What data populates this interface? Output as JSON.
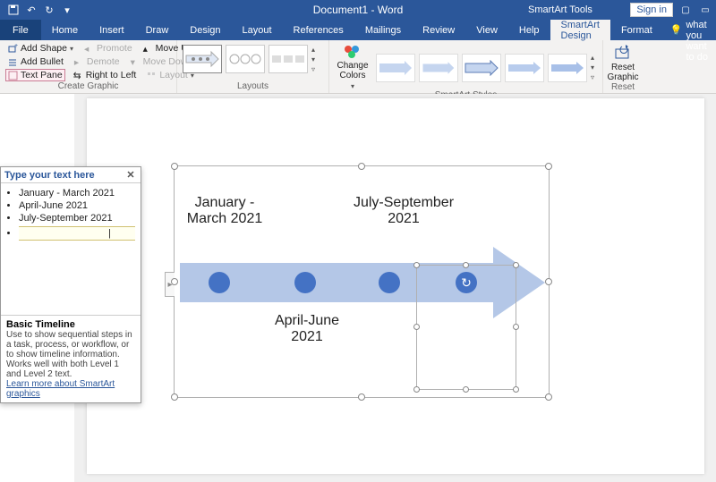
{
  "titlebar": {
    "doc": "Document1 - Word",
    "tool_context": "SmartArt Tools",
    "signin": "Sign in"
  },
  "tabs": {
    "file": "File",
    "list": [
      "Home",
      "Insert",
      "Draw",
      "Design",
      "Layout",
      "References",
      "Mailings",
      "Review",
      "View",
      "Help",
      "SmartArt Design",
      "Format"
    ],
    "active": "SmartArt Design",
    "tell": "Tell me what you want to do"
  },
  "ribbon": {
    "create": {
      "add_shape": "Add Shape",
      "add_bullet": "Add Bullet",
      "text_pane": "Text Pane",
      "promote": "Promote",
      "demote": "Demote",
      "rtl": "Right to Left",
      "move_up": "Move Up",
      "move_down": "Move Down",
      "layout": "Layout",
      "group": "Create Graphic"
    },
    "layouts": {
      "group": "Layouts"
    },
    "colors": {
      "label": "Change Colors"
    },
    "styles": {
      "group": "SmartArt Styles"
    },
    "reset": {
      "label": "Reset Graphic",
      "group": "Reset"
    }
  },
  "text_pane": {
    "title": "Type your text here",
    "items": [
      "January - March 2021",
      "April-June 2021",
      "July-September 2021"
    ],
    "editing": "",
    "info_title": "Basic Timeline",
    "info_body": "Use to show sequential steps in a task, process, or workflow, or to show timeline information. Works well with both Level 1 and Level 2 text.",
    "info_link": "Learn more about SmartArt graphics"
  },
  "timeline": {
    "label1": "January - March 2021",
    "label2": "April-June 2021",
    "label3": "July-September 2021"
  }
}
